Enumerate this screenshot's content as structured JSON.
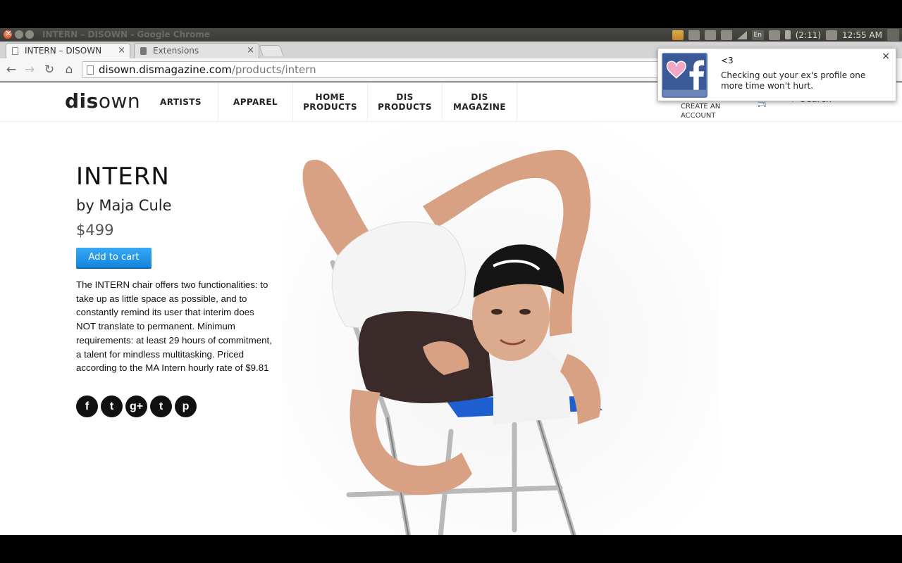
{
  "window": {
    "title": "INTERN – DISOWN - Google Chrome",
    "indicators": {
      "battery": "(2:11)",
      "clock": "12:55 AM",
      "lang": "En"
    }
  },
  "tabs": [
    {
      "label": "INTERN – DISOWN",
      "close": "×"
    },
    {
      "label": "Extensions",
      "close": "×"
    }
  ],
  "toolbar": {
    "back": "←",
    "forward": "→",
    "reload": "↻",
    "home": "⌂",
    "url_host": "disown.dismagazine.com",
    "url_path": "/products/intern"
  },
  "site": {
    "logo_bold": "dis",
    "logo_light": "own",
    "nav": [
      {
        "line1": "ARTISTS",
        "line2": ""
      },
      {
        "line1": "APPAREL",
        "line2": ""
      },
      {
        "line1": "HOME",
        "line2": "PRODUCTS"
      },
      {
        "line1": "DIS",
        "line2": "PRODUCTS"
      },
      {
        "line1": "DIS",
        "line2": "MAGAZINE"
      }
    ],
    "create_account_1": "CREATE AN",
    "create_account_2": "ACCOUNT",
    "cart_icon": "🛒",
    "search": "⌕ Search"
  },
  "product": {
    "title": "INTERN",
    "artist": "by Maja Cule",
    "price": "$499",
    "add_to_cart": "Add to cart",
    "description": "The INTERN chair offers two functionalities: to take up as little space as possible, and to constantly remind its user that interim does NOT translate to permanent. Minimum requirements: at least 29 hours of commitment, a talent for mindless multitasking. Priced according to the MA Intern hourly rate of $9.81",
    "social": [
      {
        "icon": "facebook-icon",
        "glyph": "f"
      },
      {
        "icon": "twitter-icon",
        "glyph": "t"
      },
      {
        "icon": "google-plus-icon",
        "glyph": "g+"
      },
      {
        "icon": "tumblr-icon",
        "glyph": "t"
      },
      {
        "icon": "pinterest-icon",
        "glyph": "p"
      }
    ]
  },
  "notification": {
    "title": "<3",
    "body": "Checking out your ex's profile one more time won't hurt.",
    "close": "×"
  },
  "colors": {
    "accent": "#1e8fe8",
    "facebook": "#3b5997"
  }
}
